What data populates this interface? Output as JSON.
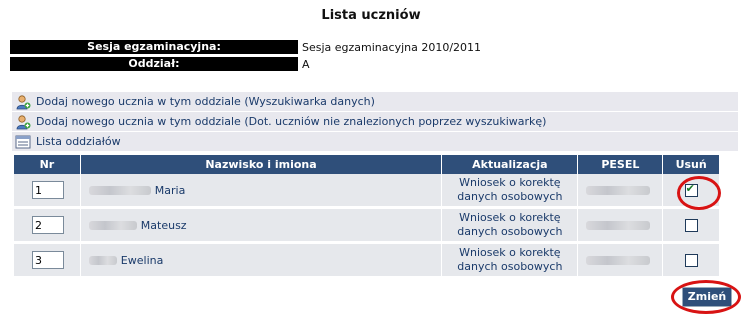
{
  "page": {
    "title": "Lista uczniów"
  },
  "info": [
    {
      "label": "Sesja egzaminacyjna:",
      "value": "Sesja egzaminacyjna 2010/2011"
    },
    {
      "label": "Oddział:",
      "value": "A"
    }
  ],
  "actions": [
    {
      "label": "Dodaj nowego ucznia w tym oddziale (Wyszukiwarka danych)",
      "icon": "add-user-icon"
    },
    {
      "label": "Dodaj nowego ucznia w tym oddziale (Dot. uczniów nie znalezionych poprzez wyszukiwarkę)",
      "icon": "add-user-icon"
    },
    {
      "label": "Lista oddziałów",
      "icon": "list-icon"
    }
  ],
  "table": {
    "headers": {
      "nr": "Nr",
      "name": "Nazwisko i imiona",
      "update": "Aktualizacja",
      "pesel": "PESEL",
      "delete": "Usuń"
    },
    "rows": [
      {
        "nr": "1",
        "first_name": "Maria",
        "update_line1": "Wniosek o korektę",
        "update_line2": "danych osobowych",
        "delete_checked": true
      },
      {
        "nr": "2",
        "first_name": "Mateusz",
        "update_line1": "Wniosek o korektę",
        "update_line2": "danych osobowych",
        "delete_checked": false
      },
      {
        "nr": "3",
        "first_name": "Ewelina",
        "update_line1": "Wniosek o korektę",
        "update_line2": "danych osobowych",
        "delete_checked": false
      }
    ]
  },
  "submit": {
    "label": "Zmień"
  },
  "colors": {
    "header_bg": "#2f4f7a",
    "highlight_ring": "#d81313"
  }
}
